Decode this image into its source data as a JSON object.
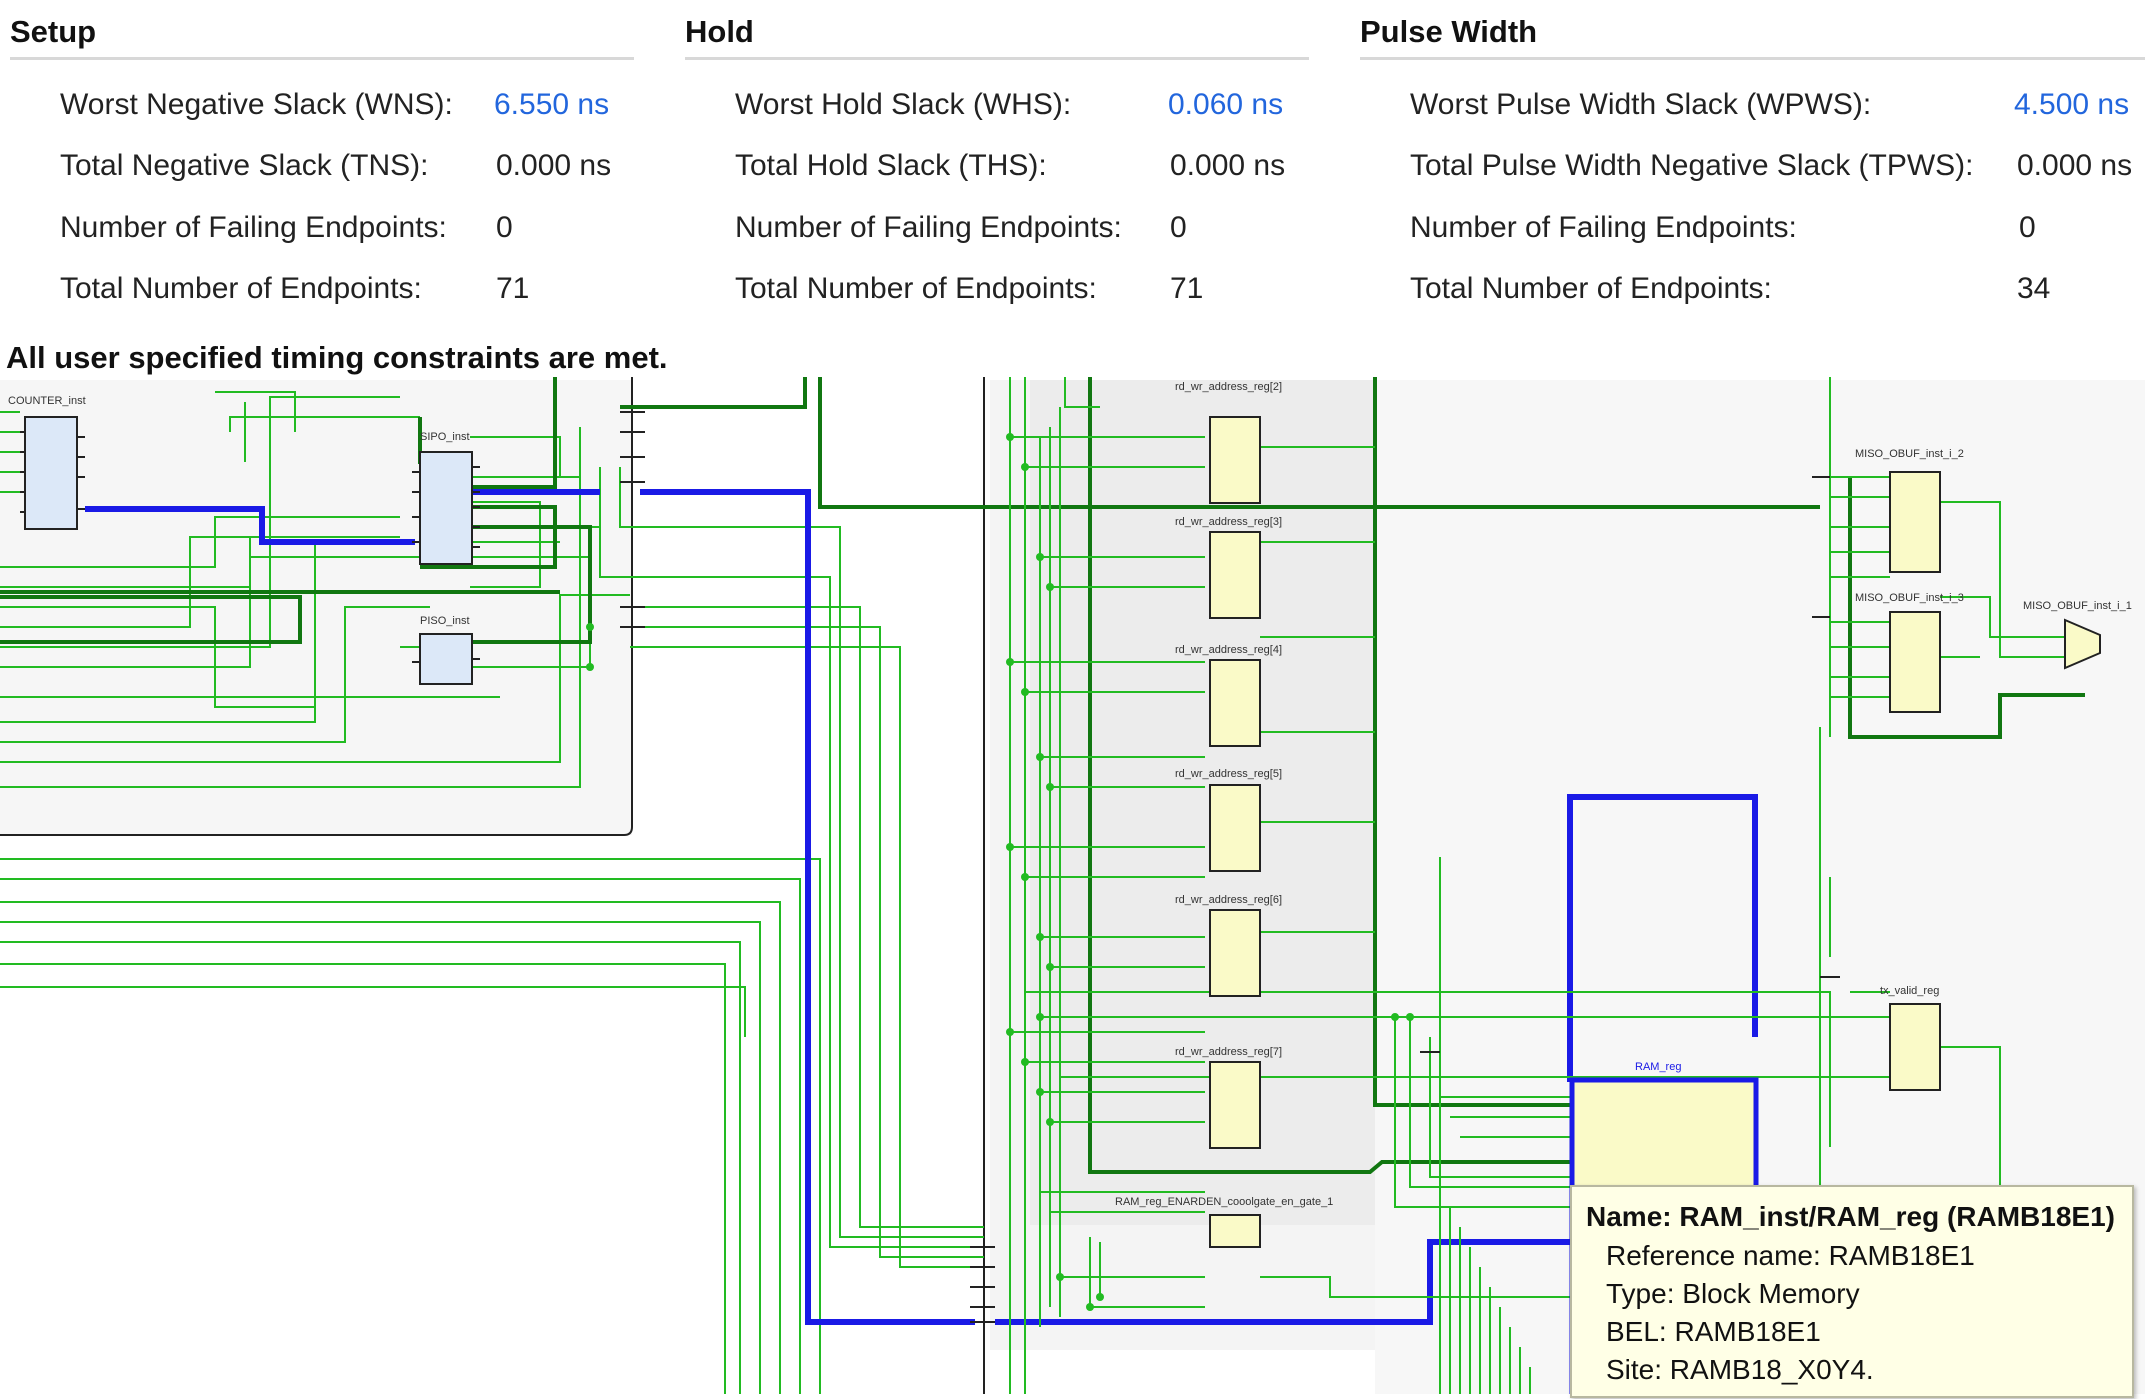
{
  "setup": {
    "title": "Setup",
    "wns_label": "Worst Negative Slack (WNS):",
    "wns_value": "6.550 ns",
    "tns_label": "Total Negative Slack (TNS):",
    "tns_value": "0.000 ns",
    "failing_label": "Number of Failing Endpoints:",
    "failing_value": "0",
    "total_label": "Total Number of Endpoints:",
    "total_value": "71"
  },
  "hold": {
    "title": "Hold",
    "whs_label": "Worst Hold Slack (WHS):",
    "whs_value": "0.060 ns",
    "ths_label": "Total Hold Slack (THS):",
    "ths_value": "0.000 ns",
    "failing_label": "Number of Failing Endpoints:",
    "failing_value": "0",
    "total_label": "Total Number of Endpoints:",
    "total_value": "71"
  },
  "pulse_width": {
    "title": "Pulse Width",
    "wpws_label": "Worst Pulse Width Slack (WPWS):",
    "wpws_value": "4.500 ns",
    "tpws_label": "Total Pulse Width Negative Slack (TPWS):",
    "tpws_value": "0.000 ns",
    "failing_label": "Number of Failing Endpoints:",
    "failing_value": "0",
    "total_label": "Total Number of Endpoints:",
    "total_value": "34"
  },
  "status_message": "All user specified timing constraints are met.",
  "schematic": {
    "cells": {
      "counter": "COUNTER_inst",
      "sipo": "SIPO_inst",
      "piso": "PISO_inst",
      "rd_wr_2": "rd_wr_address_reg[2]",
      "rd_wr_3": "rd_wr_address_reg[3]",
      "rd_wr_4": "rd_wr_address_reg[4]",
      "rd_wr_5": "rd_wr_address_reg[5]",
      "rd_wr_6": "rd_wr_address_reg[6]",
      "rd_wr_7": "rd_wr_address_reg[7]",
      "ram_gate": "RAM_reg_ENARDEN_cooolgate_en_gate_1",
      "ram_reg": "RAM_reg",
      "miso_2": "MISO_OBUF_inst_i_2",
      "miso_3": "MISO_OBUF_inst_i_3",
      "miso_1": "MISO_OBUF_inst_i_1",
      "tx_valid": "tx_valid_reg"
    },
    "colors": {
      "net": "#22bb22",
      "bus": "#117711",
      "highlight": "#1a1ae6",
      "cell_fill": "#fafac8",
      "hier_fill": "#dce8f8",
      "boundary": "#222222"
    }
  },
  "tooltip": {
    "name": "Name: RAM_inst/RAM_reg (RAMB18E1)",
    "reference": "Reference name: RAMB18E1",
    "type": "Type: Block Memory",
    "bel": "BEL: RAMB18E1",
    "site": "Site: RAMB18_X0Y4."
  }
}
